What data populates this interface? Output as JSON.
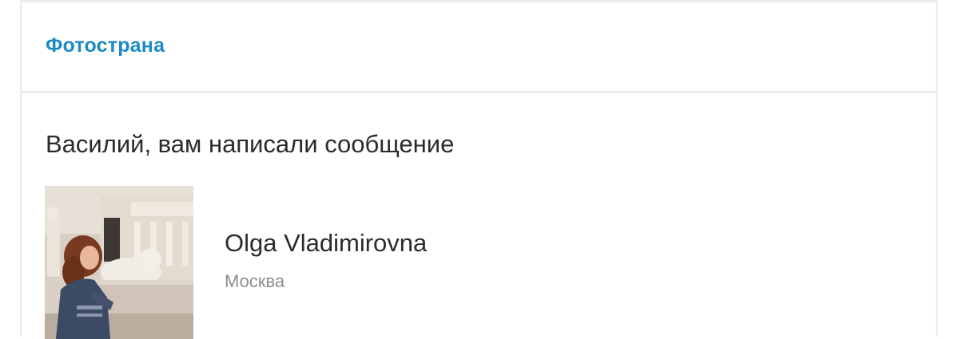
{
  "header": {
    "brand": "Фотострана"
  },
  "message": {
    "heading": "Василий, вам написали сообщение"
  },
  "sender": {
    "name": "Olga Vladimirovna",
    "city": "Москва"
  },
  "colors": {
    "brand": "#1b8ac3",
    "border": "#e6ecef",
    "text": "#2b2b2b",
    "muted": "#8a8e92"
  }
}
